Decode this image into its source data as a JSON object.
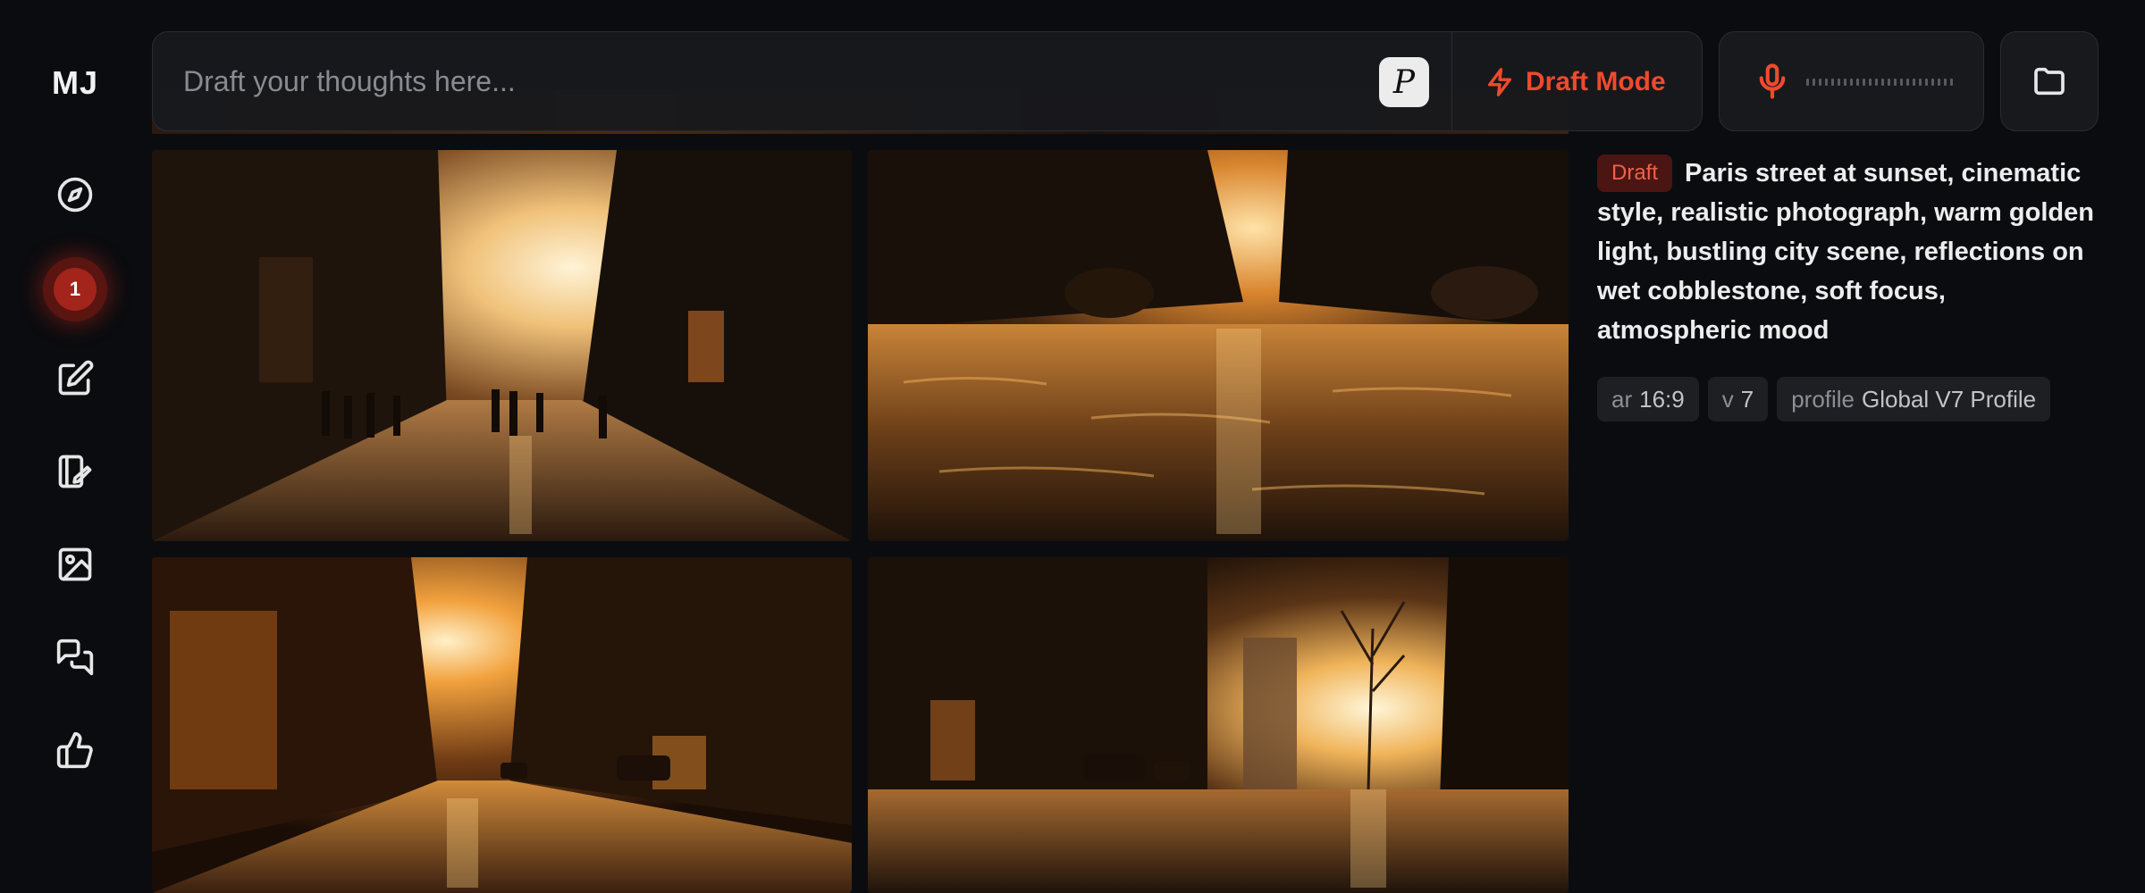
{
  "sidebar": {
    "logo": "MJ",
    "badge_count": "1",
    "items": [
      {
        "name": "explore",
        "icon": "compass-icon"
      },
      {
        "name": "create",
        "icon": "edit-icon"
      },
      {
        "name": "edit",
        "icon": "paint-edit-icon"
      },
      {
        "name": "organize",
        "icon": "image-icon"
      },
      {
        "name": "chat",
        "icon": "chat-icon"
      },
      {
        "name": "rank",
        "icon": "thumbs-up-icon"
      }
    ]
  },
  "prompt_bar": {
    "placeholder": "Draft your thoughts here...",
    "personalize_label": "P",
    "draft_mode_label": "Draft Mode"
  },
  "colors": {
    "accent": "#ef4a2d",
    "background": "#0b0c0f",
    "panel": "#18191d"
  },
  "details": {
    "tag": "Draft",
    "prompt": "Paris street at sunset, cinematic style, realistic photograph, warm golden light, bustling city scene, reflections on wet cobblestone, soft focus, atmospheric mood",
    "params": [
      {
        "key": "ar",
        "value": "16:9"
      },
      {
        "key": "v",
        "value": "7"
      },
      {
        "key": "profile",
        "value": "Global V7 Profile"
      }
    ]
  }
}
